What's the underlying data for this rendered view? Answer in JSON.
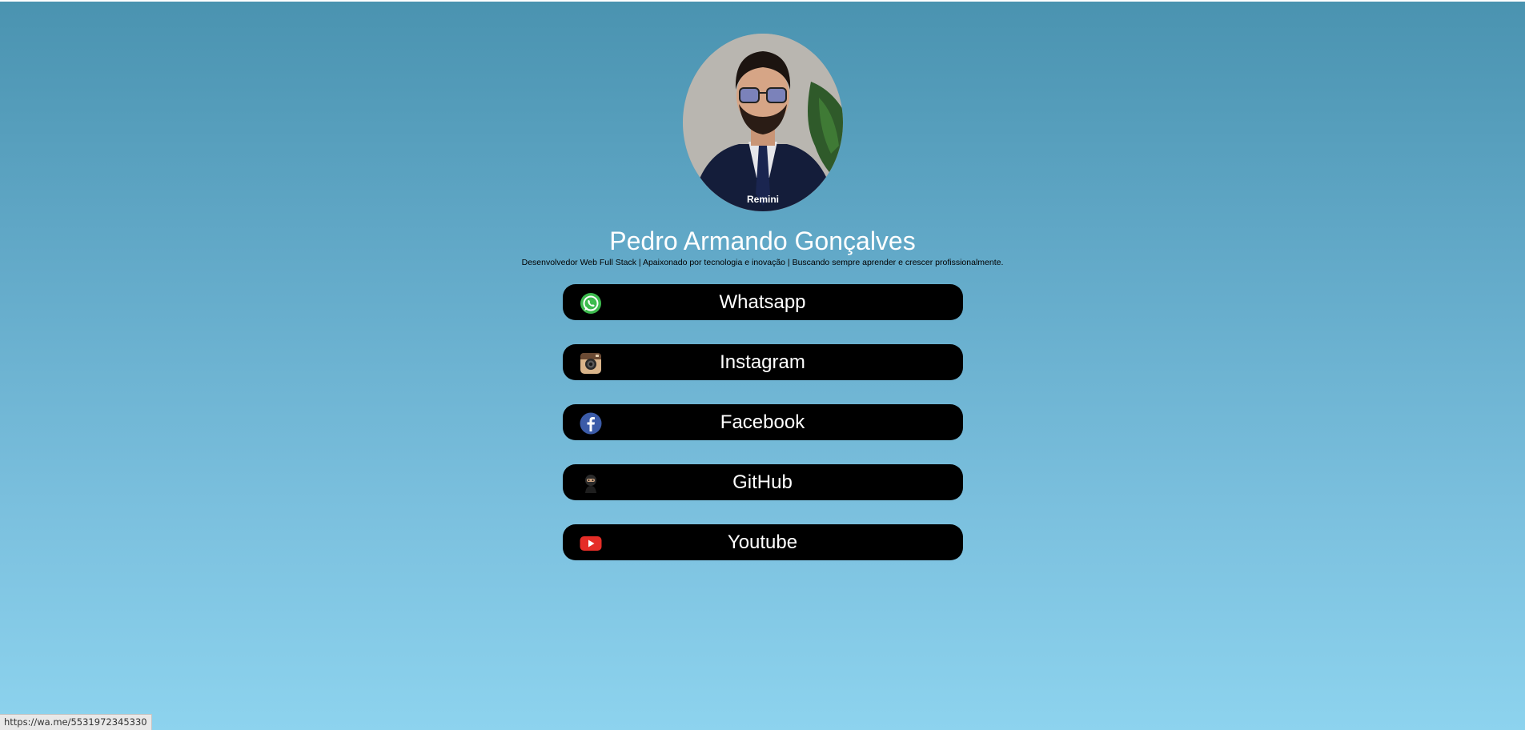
{
  "profile": {
    "name": "Pedro Armando Gonçalves",
    "bio": "Desenvolvedor Web Full Stack | Apaixonado por tecnologia e inovação | Buscando sempre aprender e crescer profissionalmente.",
    "avatar_watermark": "Remini"
  },
  "links": [
    {
      "label": "Whatsapp",
      "icon": "whatsapp-icon"
    },
    {
      "label": "Instagram",
      "icon": "instagram-icon"
    },
    {
      "label": "Facebook",
      "icon": "facebook-icon"
    },
    {
      "label": "GitHub",
      "icon": "github-icon"
    },
    {
      "label": "Youtube",
      "icon": "youtube-icon"
    }
  ],
  "status_bar": {
    "url": "https://wa.me/5531972345330"
  },
  "colors": {
    "background_top": "#4a93b0",
    "background_bottom": "#8dd3ee",
    "button": "#000000",
    "name_text": "#ffffff"
  }
}
